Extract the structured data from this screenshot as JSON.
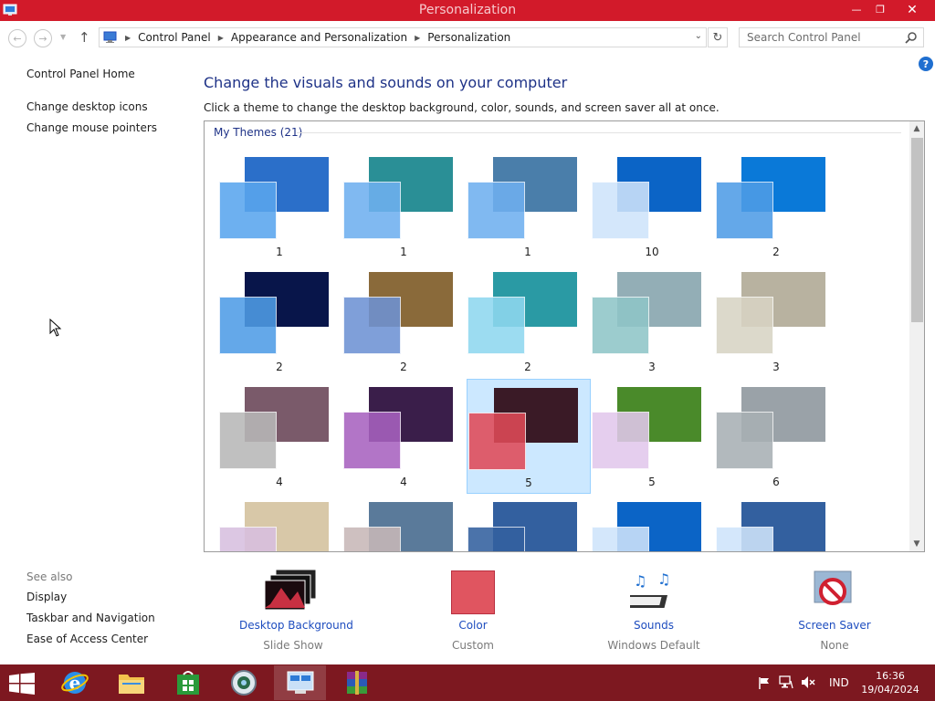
{
  "window": {
    "title": "Personalization"
  },
  "address": {
    "crumbs": [
      "Control Panel",
      "Appearance and Personalization",
      "Personalization"
    ],
    "search_placeholder": "Search Control Panel"
  },
  "left_pane": {
    "home": "Control Panel Home",
    "links": [
      "Change desktop icons",
      "Change mouse pointers"
    ],
    "see_also_title": "See also",
    "see_also": [
      "Display",
      "Taskbar and Navigation",
      "Ease of Access Center"
    ]
  },
  "main": {
    "heading": "Change the visuals and sounds on your computer",
    "subheading": "Click a theme to change the desktop background, color, sounds, and screen saver all at once.",
    "group_label": "My Themes (21)",
    "themes": [
      {
        "label": "1",
        "bg": "#2b6fc9",
        "swatch": "#5aa6ee",
        "selected": false
      },
      {
        "label": "1",
        "bg": "#2a8f96",
        "swatch": "#6fb0f0",
        "selected": false
      },
      {
        "label": "1",
        "bg": "#4a7eaa",
        "swatch": "#6fb0f0",
        "selected": false
      },
      {
        "label": "10",
        "bg": "#0b64c6",
        "swatch": "#cfe4fb",
        "selected": false
      },
      {
        "label": "2",
        "bg": "#0a79d8",
        "swatch": "#4f9de6",
        "selected": false
      },
      {
        "label": "2",
        "bg": "#08154a",
        "swatch": "#4f9de6",
        "selected": false
      },
      {
        "label": "2",
        "bg": "#8a6a3a",
        "swatch": "#6e92d4",
        "selected": false
      },
      {
        "label": "2",
        "bg": "#2a9aa4",
        "swatch": "#8fd8f0",
        "selected": false
      },
      {
        "label": "3",
        "bg": "#93aeb6",
        "swatch": "#8fc5c8",
        "selected": false
      },
      {
        "label": "3",
        "bg": "#b8b2a0",
        "swatch": "#d8d4c4",
        "selected": false
      },
      {
        "label": "4",
        "bg": "#7a5a6a",
        "swatch": "#b8b8b8",
        "selected": false
      },
      {
        "label": "4",
        "bg": "#3a1e4a",
        "swatch": "#a862c0",
        "selected": false
      },
      {
        "label": "5",
        "bg": "#3a1a26",
        "swatch": "#e04a58",
        "selected": true
      },
      {
        "label": "5",
        "bg": "#4a8a2a",
        "swatch": "#e2c8ec",
        "selected": false
      },
      {
        "label": "6",
        "bg": "#9aa2a8",
        "swatch": "#a8b0b4",
        "selected": false
      },
      {
        "label": "",
        "bg": "#d8c8a8",
        "swatch": "#d8c0e0",
        "selected": false
      },
      {
        "label": "",
        "bg": "#5a7a9a",
        "swatch": "#c8b8b8",
        "selected": false
      },
      {
        "label": "",
        "bg": "#33609f",
        "swatch": "#33609f",
        "selected": false
      },
      {
        "label": "",
        "bg": "#0b64c6",
        "swatch": "#cfe4fb",
        "selected": false
      },
      {
        "label": "",
        "bg": "#33609f",
        "swatch": "#cfe4fb",
        "selected": false
      }
    ]
  },
  "options": {
    "background": {
      "name": "Desktop Background",
      "value": "Slide Show"
    },
    "color": {
      "name": "Color",
      "value": "Custom",
      "swatch": "#e05560"
    },
    "sounds": {
      "name": "Sounds",
      "value": "Windows Default"
    },
    "screensaver": {
      "name": "Screen Saver",
      "value": "None"
    }
  },
  "taskbar": {
    "lang": "IND",
    "time": "16:36",
    "date": "19/04/2024"
  },
  "colors": {
    "title_bar": "#d21a2a",
    "taskbar": "#7d1820",
    "link_blue": "#1e4dbf",
    "heading_blue": "#1e3287"
  }
}
